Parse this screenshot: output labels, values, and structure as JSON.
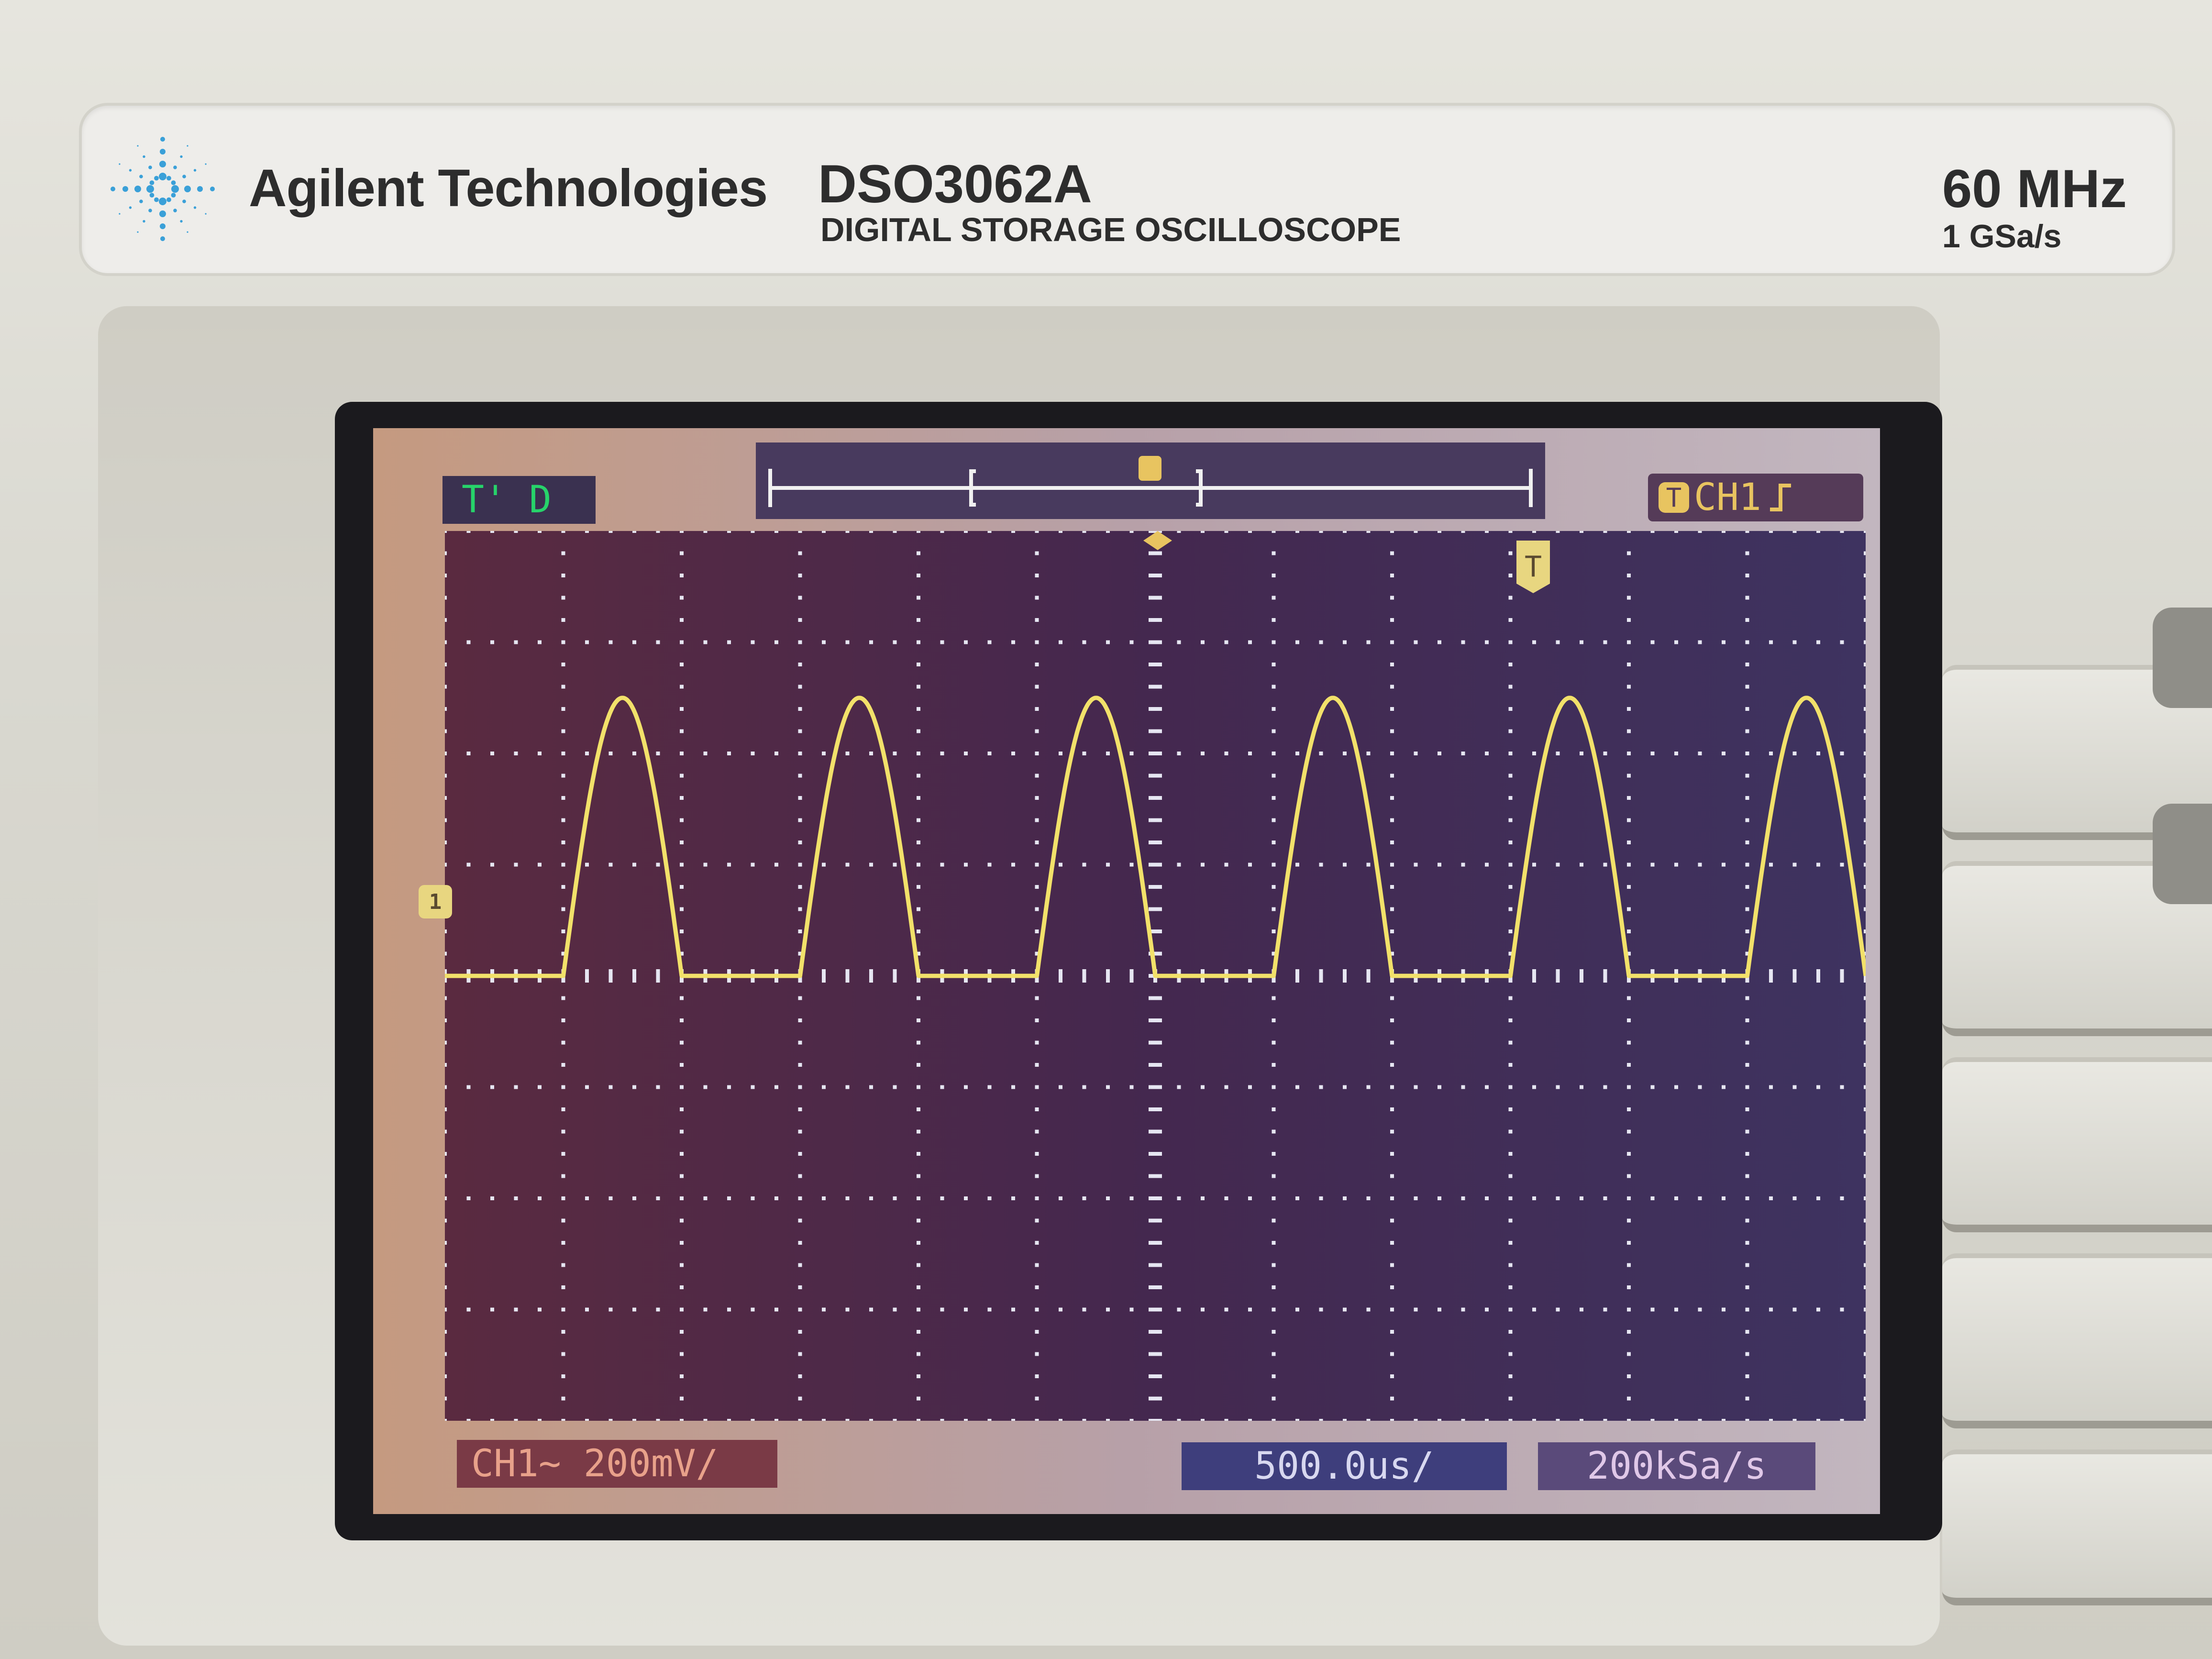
{
  "brand": {
    "name": "Agilent Technologies",
    "model": "DSO3062A",
    "model_desc": "DIGITAL STORAGE OSCILLOSCOPE",
    "bandwidth": "60 MHz",
    "sample_rate_max": "1 GSa/s"
  },
  "screen": {
    "trigger_status": "T' D",
    "trigger_source": "CH1",
    "trigger_edge_icon": "rising-edge-icon",
    "ch1_marker": "1",
    "trigger_pos_marker": "T",
    "ch1_scale": "CH1~ 200mV/",
    "timebase": "500.0us/",
    "sample_rate": "200kSa/s"
  },
  "colors": {
    "trace": "#f2e16a",
    "grid_dots": "#e6e6f2",
    "trigger_status_text": "#27d36a"
  },
  "chart_data": {
    "type": "line",
    "title": "",
    "xlabel": "",
    "ylabel": "",
    "x_divisions": 12,
    "y_divisions": 8,
    "xlim": [
      0,
      12
    ],
    "ylim": [
      -4,
      4
    ],
    "series": [
      {
        "waveform": "half-wave rectified sine",
        "baseline_div": 0,
        "peak_div": 2.5,
        "pulse_width_div": 1.0,
        "period_div": 2.0,
        "first_pulse_start_div": 1.0,
        "pulses_visible": 6
      }
    ]
  }
}
